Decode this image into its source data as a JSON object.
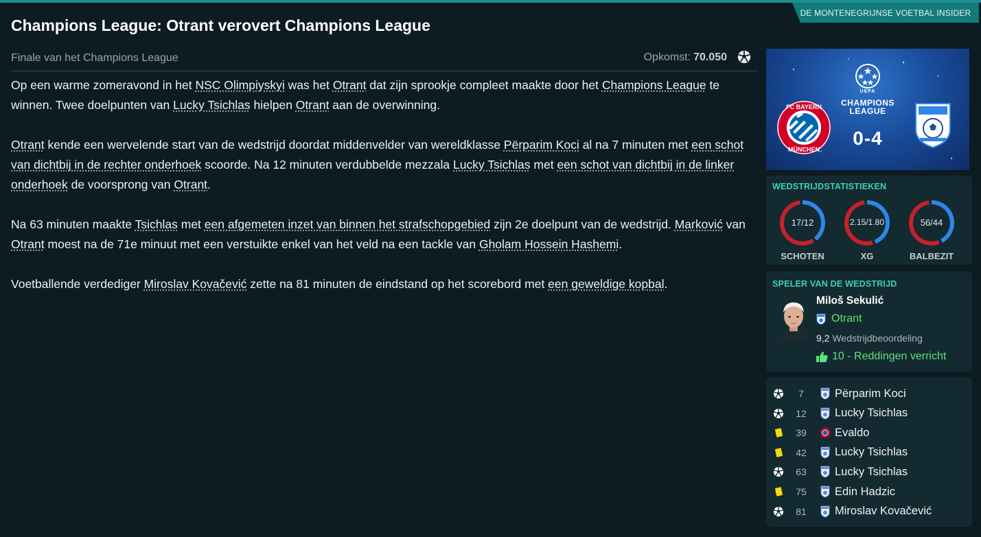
{
  "source_tag": "DE MONTENEGRIJNSE VOETBAL INSIDER",
  "headline": "Champions League: Otrant verovert Champions League",
  "subtitle": "Finale van het Champions League",
  "attendance": {
    "label": "Opkomst:",
    "value": "70.050"
  },
  "banner": {
    "home_badge_top": "FC BAYERN",
    "home_badge_bottom": "MÜNCHEN",
    "competition_line1": "CHAMPIONS",
    "competition_line2": "LEAGUE",
    "uefa": "UEFA",
    "score": "0-4"
  },
  "article": {
    "p1": [
      {
        "t": "Op een warme zomeravond in het "
      },
      {
        "t": "NSC Olimpiyskyi",
        "l": true
      },
      {
        "t": " was het "
      },
      {
        "t": "Otrant",
        "l": true
      },
      {
        "t": " dat zijn sprookje compleet maakte door het "
      },
      {
        "t": "Champions League",
        "l": true
      },
      {
        "t": " te winnen. Twee doelpunten van "
      },
      {
        "t": "Lucky Tsichlas",
        "l": true
      },
      {
        "t": " hielpen "
      },
      {
        "t": "Otrant",
        "l": true
      },
      {
        "t": " aan de overwinning."
      }
    ],
    "p2": [
      {
        "t": "Otrant",
        "l": true
      },
      {
        "t": " kende een wervelende start van de wedstrijd doordat middenvelder van wereldklasse "
      },
      {
        "t": "Përparim Koci",
        "l": true
      },
      {
        "t": " al na 7 minuten met "
      },
      {
        "t": "een schot van dichtbij in de rechter onderhoek",
        "l": true
      },
      {
        "t": " scoorde. Na 12 minuten verdubbelde mezzala "
      },
      {
        "t": "Lucky Tsichlas",
        "l": true
      },
      {
        "t": " met "
      },
      {
        "t": "een schot van dichtbij in de linker onderhoek",
        "l": true
      },
      {
        "t": " de voorsprong van "
      },
      {
        "t": "Otrant",
        "l": true
      },
      {
        "t": "."
      }
    ],
    "p3": [
      {
        "t": "Na 63 minuten maakte "
      },
      {
        "t": "Tsichlas",
        "l": true
      },
      {
        "t": " met "
      },
      {
        "t": "een afgemeten inzet van binnen het strafschopgebied",
        "l": true
      },
      {
        "t": " zijn 2e doelpunt van de wedstrijd. "
      },
      {
        "t": "Marković",
        "l": true
      },
      {
        "t": " van "
      },
      {
        "t": "Otrant",
        "l": true
      },
      {
        "t": " moest na de 71e minuut met een verstuikte enkel van het veld na een tackle van "
      },
      {
        "t": "Gholam Hossein Hashemi",
        "l": true
      },
      {
        "t": "."
      }
    ],
    "p4": [
      {
        "t": "Voetballende verdediger "
      },
      {
        "t": "Miroslav Kovačević",
        "l": true
      },
      {
        "t": " zette na 81 minuten de eindstand op het scorebord met "
      },
      {
        "t": "een geweldige kopbal",
        "l": true
      },
      {
        "t": "."
      }
    ]
  },
  "match_stats": {
    "title": "WEDSTRIJDSTATISTIEKEN",
    "colors": {
      "home": "#c8202a",
      "away": "#2f86e6"
    },
    "items": [
      {
        "label": "SCHOTEN",
        "display": "17/12",
        "home": 17,
        "away": 12
      },
      {
        "label": "XG",
        "display": "2.15/1.80",
        "home": 2.15,
        "away": 1.8
      },
      {
        "label": "BALBEZIT",
        "display": "56/44",
        "home": 56,
        "away": 44
      }
    ]
  },
  "player_of_match": {
    "title": "SPELER VAN DE WEDSTRIJD",
    "name": "Miloš Sekulić",
    "club": "Otrant",
    "rating": "9,2",
    "rating_label": "Wedstrijdbeoordeling",
    "highlight": "10 - Reddingen verricht"
  },
  "events": [
    {
      "type": "goal-icon",
      "minute": "7",
      "team": "otrant-crest-icon",
      "player": "Përparim Koci"
    },
    {
      "type": "goal-icon",
      "minute": "12",
      "team": "otrant-crest-icon",
      "player": "Lucky Tsichlas"
    },
    {
      "type": "yellow-card-icon",
      "minute": "39",
      "team": "bayern-crest-icon",
      "player": "Evaldo"
    },
    {
      "type": "yellow-card-icon",
      "minute": "42",
      "team": "otrant-crest-icon",
      "player": "Lucky Tsichlas"
    },
    {
      "type": "goal-icon",
      "minute": "63",
      "team": "otrant-crest-icon",
      "player": "Lucky Tsichlas"
    },
    {
      "type": "yellow-card-icon",
      "minute": "75",
      "team": "otrant-crest-icon",
      "player": "Edin Hadzic"
    },
    {
      "type": "goal-icon",
      "minute": "81",
      "team": "otrant-crest-icon",
      "player": "Miroslav Kovačević"
    }
  ]
}
